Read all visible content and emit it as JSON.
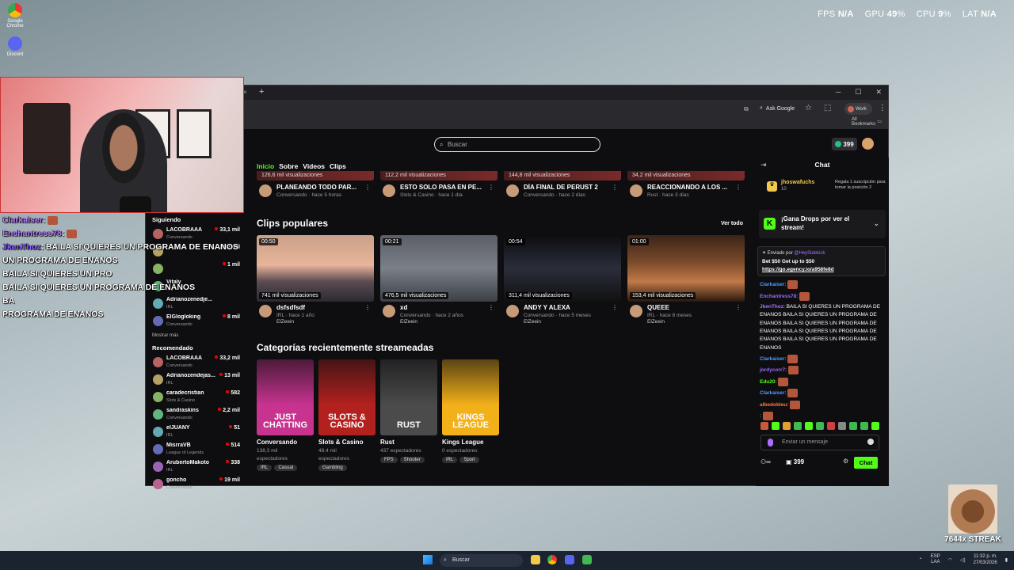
{
  "overlay": {
    "fps_label": "FPS",
    "fps_value": "N/A",
    "gpu_label": "GPU",
    "gpu_value": "49",
    "cpu_label": "CPU",
    "cpu_value": "9",
    "lat_label": "LAT",
    "lat_value": "N/A",
    "pct": "%"
  },
  "desktop_icons": [
    "Google Chrome",
    "Discord"
  ],
  "stream_chat": [
    {
      "user": "Clarkaiser",
      "text": ":"
    },
    {
      "user": "Enchantress78",
      "text": ":"
    },
    {
      "user": "JkenThoz",
      "text": ": BAILA SI QUIERES UN PROGRAMA DE ENANOS"
    },
    {
      "user": "",
      "text": "UN PROGRAMA DE ENANOS"
    },
    {
      "user": "",
      "text": "BAILA SI QUIERES UN PRO"
    },
    {
      "user": "",
      "text": "BAILA SI QUIERES UN PROGRAMA DE ENANOS"
    },
    {
      "user": "",
      "text": "BA"
    },
    {
      "user": "",
      "text": "PROGRAMA DE ENANOS"
    }
  ],
  "browser": {
    "tab_close": "×",
    "new_tab": "+",
    "win_min": "─",
    "win_max": "☐",
    "win_close": "✕",
    "ask_google": "Ask Google",
    "profile": "Work",
    "all_bookmarks": "All Bookmarks"
  },
  "topnav": {
    "search_placeholder": "Buscar",
    "points": "399"
  },
  "sidebar": {
    "following_title": "Siguiendo",
    "following": [
      {
        "name": "LACOBRAAA",
        "category": "Conversando",
        "viewers": "33,1 mil"
      },
      {
        "name": "",
        "category": "",
        "viewers": "22,2 mil"
      },
      {
        "name": "",
        "category": "",
        "viewers": "1 mil"
      },
      {
        "name": "Vitaly",
        "category": "IRL",
        "viewers": ""
      },
      {
        "name": "Adrianozenedje...",
        "category": "IRL",
        "viewers": ""
      },
      {
        "name": "ElGlogloking",
        "category": "Conversando",
        "viewers": "8 mil"
      }
    ],
    "show_more": "Mostrar más",
    "recommended_title": "Recomendado",
    "recommended": [
      {
        "name": "LACOBRAAA",
        "category": "Conversando",
        "viewers": "33,2 mil"
      },
      {
        "name": "Adrianozendejas...",
        "category": "IRL",
        "viewers": "13 mil"
      },
      {
        "name": "caradecristian",
        "category": "Slots & Casino",
        "viewers": "582"
      },
      {
        "name": "sandraskins",
        "category": "Conversando",
        "viewers": "2,2 mil"
      },
      {
        "name": "elJUANY",
        "category": "IRL",
        "viewers": "51"
      },
      {
        "name": "MisrraVB",
        "category": "League of Legends",
        "viewers": "514"
      },
      {
        "name": "ArubertoMakoto",
        "category": "IRL",
        "viewers": "338"
      },
      {
        "name": "goncho",
        "category": "Conversando",
        "viewers": "19 mil"
      }
    ]
  },
  "channel_tabs": [
    "Inicio",
    "Sobre",
    "Videos",
    "Clips"
  ],
  "videos": [
    {
      "views": "126,6 mil visualizaciones",
      "title": "PLANEANDO TODO PAR...",
      "sub": "Conversando · hace 5 horas"
    },
    {
      "views": "112,2 mil visualizaciones",
      "title": "ESTO SOLO PASA EN PE...",
      "sub": "Slots & Casino · hace 1 día"
    },
    {
      "views": "144,8 mil visualizaciones",
      "title": "DÍA FINAL DE PERUST 2",
      "sub": "Conversando · hace 2 días"
    },
    {
      "views": "34,2 mil visualizaciones",
      "title": "REACCIONANDO A LOS ...",
      "sub": "Rust · hace 3 días"
    }
  ],
  "clips_title": "Clips populares",
  "see_all": "Ver todo",
  "clips": [
    {
      "duration": "00:50",
      "views": "741 mil visualizaciones",
      "title": "dsfsdfsdf",
      "sub": "IRL · hace 1 año",
      "author": "ElZeein"
    },
    {
      "duration": "00:21",
      "views": "476,5 mil visualizaciones",
      "title": "xd",
      "sub": "Conversando · hace 2 años",
      "author": "ElZeein"
    },
    {
      "duration": "00:54",
      "views": "311,4 mil visualizaciones",
      "title": "ANDY Y ALEXA",
      "sub": "Conversando · hace 5 meses",
      "author": "ElZeein"
    },
    {
      "duration": "01:00",
      "views": "153,4 mil visualizaciones",
      "title": "QUEEE",
      "sub": "IRL · hace 8 meses",
      "author": "ElZeein"
    }
  ],
  "categories_title": "Categorías recientemente streameadas",
  "categories": [
    {
      "art": "JUST CHATTING",
      "name": "Conversando",
      "viewers": "138,3 mil",
      "viewers_label": "espectadores",
      "tags": [
        "IRL",
        "Casual"
      ],
      "color": "#c7338f"
    },
    {
      "art": "SLOTS & CASINO",
      "name": "Slots & Casino",
      "viewers": "48,4 mil",
      "viewers_label": "espectadores",
      "tags": [
        "Gambling"
      ],
      "color": "#b3211f"
    },
    {
      "art": "RUST",
      "name": "Rust",
      "viewers": "437 espectadores",
      "viewers_label": "",
      "tags": [
        "FPS",
        "Shooter"
      ],
      "color": "#4b4b4b"
    },
    {
      "art": "KINGS LEAGUE",
      "name": "Kings League",
      "viewers": "0 espectadores",
      "viewers_label": "",
      "tags": [
        "IRL",
        "Sport"
      ],
      "color": "#f2b019"
    }
  ],
  "chat": {
    "title": "Chat",
    "pinned_user": "jhoswafuchs",
    "pinned_amount": "10",
    "pinned_text": "Regala 1 suscripción para tomar la posición 2",
    "drops": "¡Gana Drops por ver el stream!",
    "sent_by": "Enviado por",
    "sent_user": "@HeySidekick",
    "sent_text": "Bet $50 Get up to $50",
    "sent_link": "https://go.egency.io/a958fe8d",
    "messages": [
      {
        "user": "Clarkaiser",
        "text": ":",
        "cls": "u3"
      },
      {
        "user": "Enchantress78",
        "text": ":",
        "cls": "u6"
      },
      {
        "user": "JkenThoz",
        "text": ": BAILA SI QUIERES UN PROGRAMA DE ENANOS BAILA SI QUIERES UN PROGRAMA DE ENANOS BAILA SI QUIERES UN PROGRAMA DE ENANOS BAILA SI QUIERES UN PROGRAMA DE ENANOS BAILA SI QUIERES UN PROGRAMA DE ENANOS",
        "cls": "u1"
      },
      {
        "user": "Clarkaiser",
        "text": ":",
        "cls": "u3"
      },
      {
        "user": "jordycorr7",
        "text": ":",
        "cls": "u6"
      },
      {
        "user": "Edu20",
        "text": ":",
        "cls": "u2"
      },
      {
        "user": "Clarkaiser",
        "text": ":",
        "cls": "u3"
      },
      {
        "user": "albedobleu",
        "text": ":",
        "cls": "u4"
      },
      {
        "user": "",
        "text": ":",
        "cls": "u5"
      }
    ],
    "input_placeholder": "Enviar un mensaje",
    "points": "399",
    "send": "Chat"
  },
  "taskbar": {
    "search": "Buscar",
    "lang": "ESP",
    "lang2": "LAA",
    "time": "11:32 p. m.",
    "date": "27/03/2026"
  },
  "streak": {
    "text": "7644x STREAK"
  }
}
